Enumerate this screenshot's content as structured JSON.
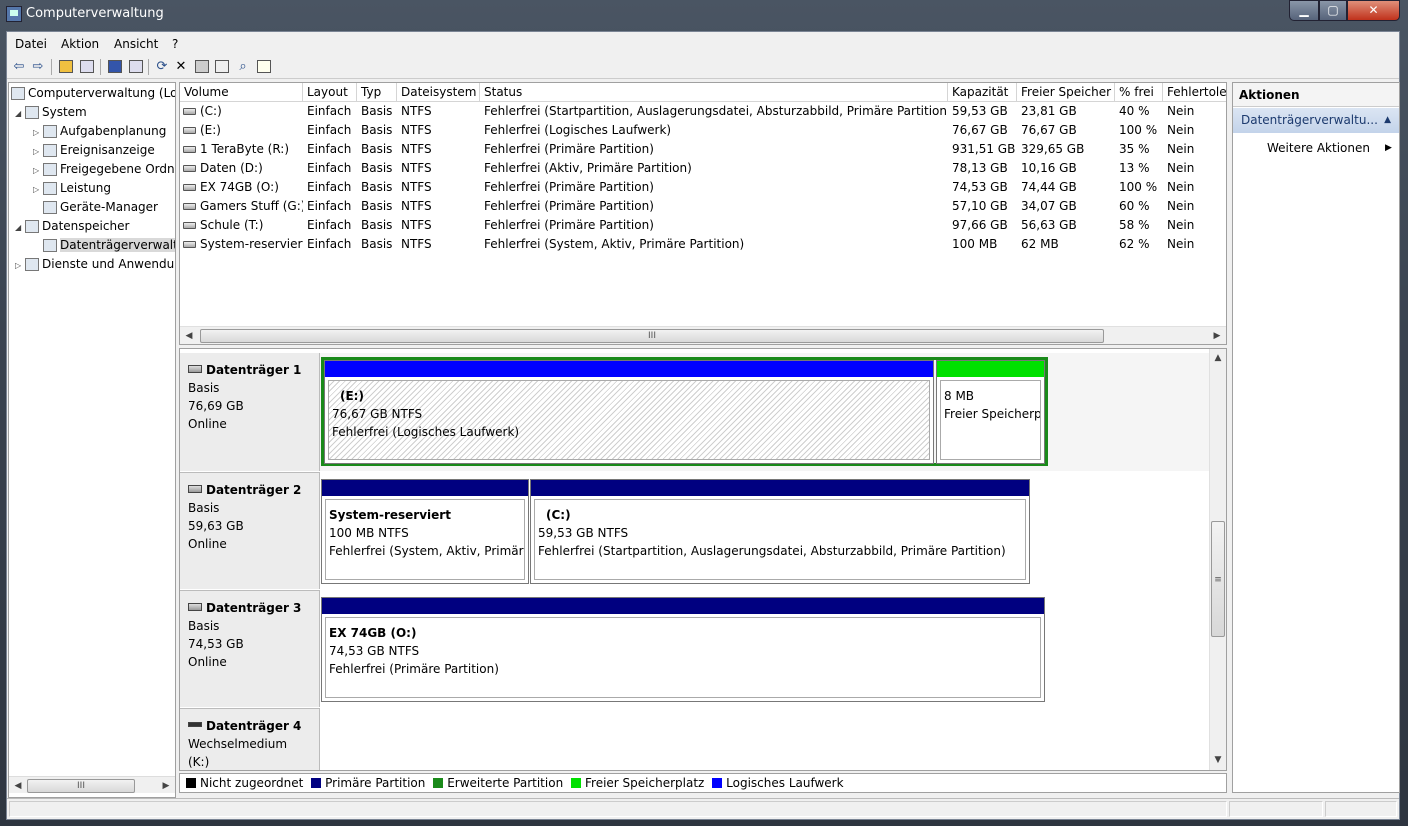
{
  "window": {
    "title": "Computerverwaltung",
    "min": "▁",
    "max": "▢",
    "close": "✕"
  },
  "menu": [
    "Datei",
    "Aktion",
    "Ansicht",
    "?"
  ],
  "toolbar": [
    "back-icon",
    "forward-icon",
    "up-folder-icon",
    "show-hide-tree-icon",
    "help-icon",
    "properties-icon",
    "refresh-icon",
    "delete-icon",
    "disk-props-icon",
    "open-icon",
    "search-icon",
    "format-icon"
  ],
  "tree": {
    "items": [
      {
        "label": "Computerverwaltung (Lo",
        "expander": ""
      },
      {
        "label": "System",
        "expander": "◢"
      },
      {
        "label": "Aufgabenplanung",
        "expander": "▷"
      },
      {
        "label": "Ereignisanzeige",
        "expander": "▷"
      },
      {
        "label": "Freigegebene Ordn",
        "expander": "▷"
      },
      {
        "label": "Leistung",
        "expander": "▷"
      },
      {
        "label": "Geräte-Manager",
        "expander": ""
      },
      {
        "label": "Datenspeicher",
        "expander": "◢"
      },
      {
        "label": "Datenträgerverwalt",
        "expander": ""
      },
      {
        "label": "Dienste und Anwendu",
        "expander": "▷"
      }
    ]
  },
  "volumes": {
    "columns": [
      "Volume",
      "Layout",
      "Typ",
      "Dateisystem",
      "Status",
      "Kapazität",
      "Freier Speicher",
      "% frei",
      "Fehlertole"
    ],
    "rows": [
      [
        "(C:)",
        "Einfach",
        "Basis",
        "NTFS",
        "Fehlerfrei (Startpartition, Auslagerungsdatei, Absturzabbild, Primäre Partition)",
        "59,53 GB",
        "23,81 GB",
        "40 %",
        "Nein"
      ],
      [
        "(E:)",
        "Einfach",
        "Basis",
        "NTFS",
        "Fehlerfrei (Logisches Laufwerk)",
        "76,67 GB",
        "76,67 GB",
        "100 %",
        "Nein"
      ],
      [
        "1 TeraByte (R:)",
        "Einfach",
        "Basis",
        "NTFS",
        "Fehlerfrei (Primäre Partition)",
        "931,51 GB",
        "329,65 GB",
        "35 %",
        "Nein"
      ],
      [
        "Daten (D:)",
        "Einfach",
        "Basis",
        "NTFS",
        "Fehlerfrei (Aktiv, Primäre Partition)",
        "78,13 GB",
        "10,16 GB",
        "13 %",
        "Nein"
      ],
      [
        "EX 74GB (O:)",
        "Einfach",
        "Basis",
        "NTFS",
        "Fehlerfrei (Primäre Partition)",
        "74,53 GB",
        "74,44 GB",
        "100 %",
        "Nein"
      ],
      [
        "Gamers Stuff (G:)",
        "Einfach",
        "Basis",
        "NTFS",
        "Fehlerfrei (Primäre Partition)",
        "57,10 GB",
        "34,07 GB",
        "60 %",
        "Nein"
      ],
      [
        "Schule (T:)",
        "Einfach",
        "Basis",
        "NTFS",
        "Fehlerfrei (Primäre Partition)",
        "97,66 GB",
        "56,63 GB",
        "58 %",
        "Nein"
      ],
      [
        "System-reserviert",
        "Einfach",
        "Basis",
        "NTFS",
        "Fehlerfrei (System, Aktiv, Primäre Partition)",
        "100 MB",
        "62 MB",
        "62 %",
        "Nein"
      ]
    ],
    "scroll_thumb": "III"
  },
  "disks": [
    {
      "name": "Datenträger 1",
      "type": "Basis",
      "size": "76,69 GB",
      "state": "Online",
      "partitions": [
        {
          "title": "(E:)",
          "line2": "76,67 GB NTFS",
          "line3": "Fehlerfrei (Logisches Laufwerk)",
          "bar": "#0000ff"
        },
        {
          "title": "",
          "line2": "8 MB",
          "line3": "Freier Speicherp",
          "bar": "#00e000"
        }
      ]
    },
    {
      "name": "Datenträger 2",
      "type": "Basis",
      "size": "59,63 GB",
      "state": "Online",
      "partitions": [
        {
          "title": "System-reserviert",
          "line2": "100 MB NTFS",
          "line3": "Fehlerfrei (System, Aktiv, Primäre",
          "bar": "#000080"
        },
        {
          "title": "(C:)",
          "line2": "59,53 GB NTFS",
          "line3": "Fehlerfrei (Startpartition, Auslagerungsdatei, Absturzabbild, Primäre Partition)",
          "bar": "#000080"
        }
      ]
    },
    {
      "name": "Datenträger 3",
      "type": "Basis",
      "size": "74,53 GB",
      "state": "Online",
      "partitions": [
        {
          "title": "EX 74GB  (O:)",
          "line2": "74,53 GB NTFS",
          "line3": "Fehlerfrei (Primäre Partition)",
          "bar": "#000080"
        }
      ]
    },
    {
      "name": "Datenträger 4",
      "type": "Wechselmedium (K:)",
      "size": "",
      "state": "",
      "partitions": []
    }
  ],
  "legend": [
    {
      "label": "Nicht zugeordnet",
      "color": "#000000"
    },
    {
      "label": "Primäre Partition",
      "color": "#000080"
    },
    {
      "label": "Erweiterte Partition",
      "color": "#1a8a1a"
    },
    {
      "label": "Freier Speicherplatz",
      "color": "#00e000"
    },
    {
      "label": "Logisches Laufwerk",
      "color": "#0000ff"
    }
  ],
  "actions": {
    "heading": "Aktionen",
    "section": "Datenträgerverwaltu...",
    "more": "Weitere Aktionen"
  }
}
